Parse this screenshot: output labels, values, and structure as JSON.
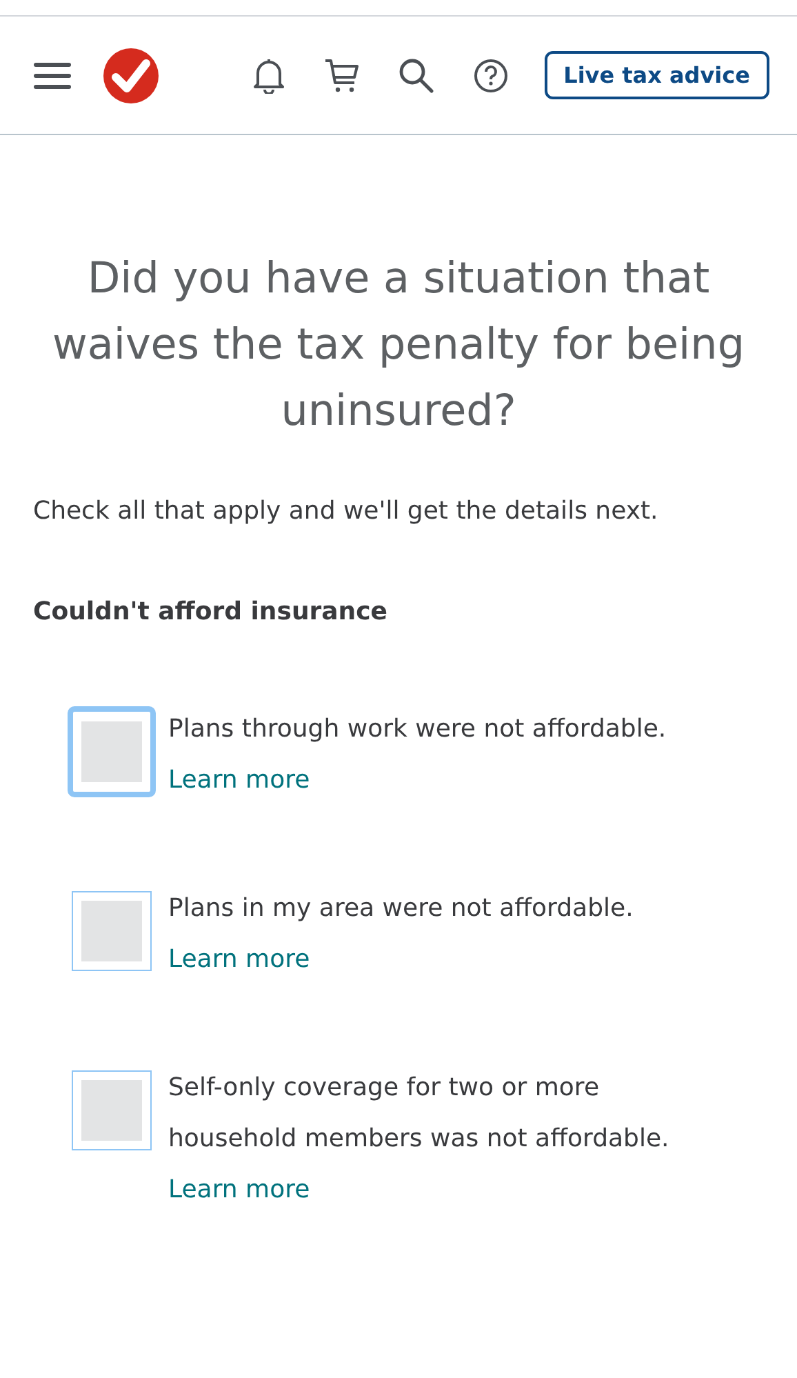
{
  "header": {
    "advice_button": "Live tax advice"
  },
  "title": "Did you have a situation that waives the tax penalty for being uninsured?",
  "instructions": "Check all that apply and we'll get the details next.",
  "section_heading": "Couldn't afford insurance",
  "options": [
    {
      "text": "Plans through work were not affordable.",
      "link": "Learn more",
      "checked": false,
      "focused": true
    },
    {
      "text": "Plans in my area were not affordable.",
      "link": "Learn more",
      "checked": false,
      "focused": false
    },
    {
      "text": "Self-only coverage for two or more household members was not affordable.",
      "link": "Learn more",
      "checked": false,
      "focused": false
    }
  ]
}
